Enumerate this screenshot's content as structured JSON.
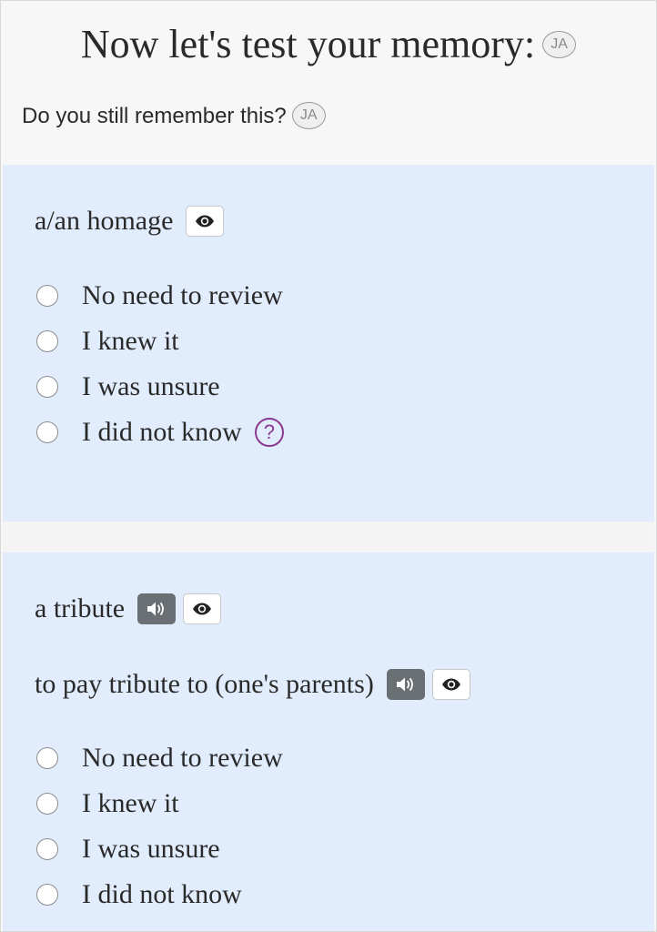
{
  "header": {
    "title": "Now let's test your memory:",
    "subtitle": "Do you still remember this?",
    "badge": "JA"
  },
  "cards": [
    {
      "terms": [
        {
          "text": "a/an homage",
          "icons": [
            "eye-icon"
          ]
        }
      ],
      "options": [
        "No need to review",
        "I knew it",
        "I was unsure",
        "I did not know"
      ],
      "help_icon": "?"
    },
    {
      "terms": [
        {
          "text": "a tribute",
          "icons": [
            "speaker-icon",
            "eye-icon"
          ]
        },
        {
          "text": "to pay tribute to (one's parents)",
          "icons": [
            "speaker-icon",
            "eye-icon"
          ]
        }
      ],
      "options": [
        "No need to review",
        "I knew it",
        "I was unsure",
        "I did not know"
      ]
    }
  ],
  "colors": {
    "card_background": "#e1ecfd",
    "audio_button": "#6a6f74",
    "help_accent": "#8b3a8f"
  }
}
